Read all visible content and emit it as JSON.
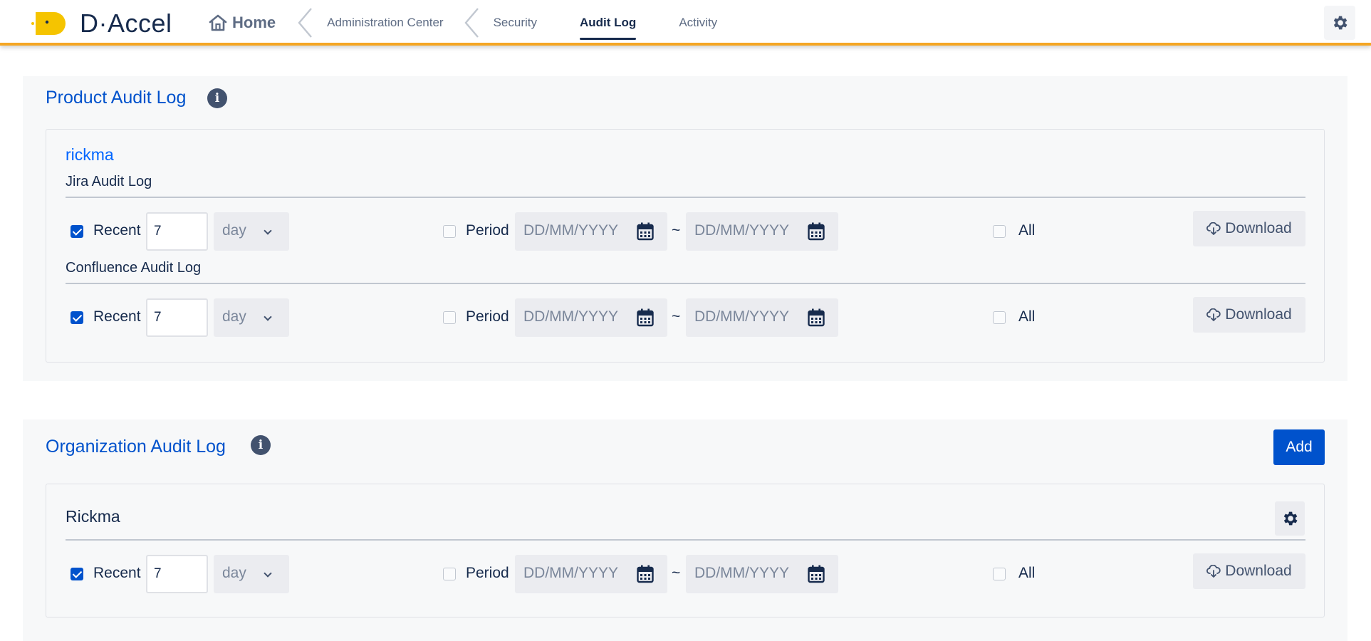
{
  "app": {
    "brand": "D·Accel"
  },
  "nav": {
    "home": "Home",
    "admin_center": "Administration Center",
    "tabs": [
      {
        "label": "Security",
        "active": false
      },
      {
        "label": "Audit Log",
        "active": true
      },
      {
        "label": "Activity",
        "active": false
      }
    ]
  },
  "product_section": {
    "title": "Product Audit Log",
    "user": "rickma",
    "logs": [
      {
        "label": "Jira Audit Log",
        "recent_checked": true,
        "recent_label": "Recent",
        "recent_value": "7",
        "unit": "day",
        "period_checked": false,
        "period_label": "Period",
        "date_from_placeholder": "DD/MM/YYYY",
        "date_to_placeholder": "DD/MM/YYYY",
        "separator": "~",
        "all_checked": false,
        "all_label": "All",
        "download_label": "Download"
      },
      {
        "label": "Confluence Audit Log",
        "recent_checked": true,
        "recent_label": "Recent",
        "recent_value": "7",
        "unit": "day",
        "period_checked": false,
        "period_label": "Period",
        "date_from_placeholder": "DD/MM/YYYY",
        "date_to_placeholder": "DD/MM/YYYY",
        "separator": "~",
        "all_checked": false,
        "all_label": "All",
        "download_label": "Download"
      }
    ]
  },
  "org_section": {
    "title": "Organization Audit Log",
    "add_label": "Add",
    "org_name": "Rickma",
    "log": {
      "recent_checked": true,
      "recent_label": "Recent",
      "recent_value": "7",
      "unit": "day",
      "period_checked": false,
      "period_label": "Period",
      "date_from_placeholder": "DD/MM/YYYY",
      "date_to_placeholder": "DD/MM/YYYY",
      "separator": "~",
      "all_checked": false,
      "all_label": "All",
      "download_label": "Download"
    }
  },
  "colors": {
    "accent": "#f5a623",
    "brand_yellow": "#f5c400",
    "primary": "#0052cc",
    "link": "#0065ff"
  },
  "icons": [
    "logo-icon",
    "home-icon",
    "chevron-left-icon",
    "gear-icon",
    "info-icon",
    "calendar-icon",
    "chevron-down-icon",
    "cloud-download-icon",
    "checkbox-icon"
  ]
}
